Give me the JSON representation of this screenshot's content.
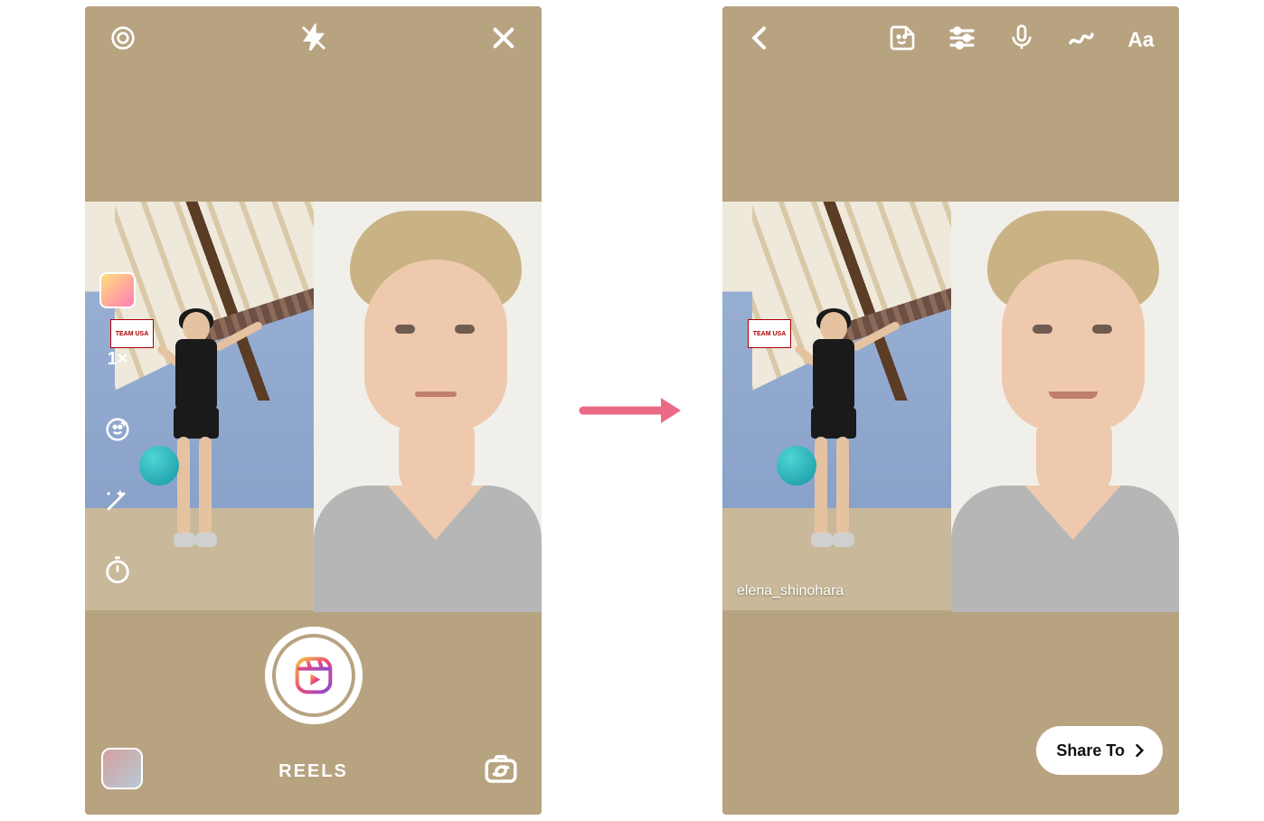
{
  "left_phone": {
    "speed": "1×",
    "mode_label": "REELS",
    "icons": {
      "settings": "settings-icon",
      "flash_off": "flash-off-icon",
      "close": "close-icon",
      "effects": "effects-sparkle-icon",
      "enhance": "magic-wand-icon",
      "timer": "timer-icon",
      "switch_camera": "camera-switch-icon"
    },
    "flag_text": "TEAM USA"
  },
  "right_phone": {
    "remix_credit": "elena_shinohara",
    "share_label": "Share To",
    "icons": {
      "back": "chevron-left-icon",
      "sticker": "sticker-icon",
      "adjust": "sliders-icon",
      "voiceover": "microphone-icon",
      "draw": "scribble-icon",
      "text": "text-aa-icon"
    }
  }
}
